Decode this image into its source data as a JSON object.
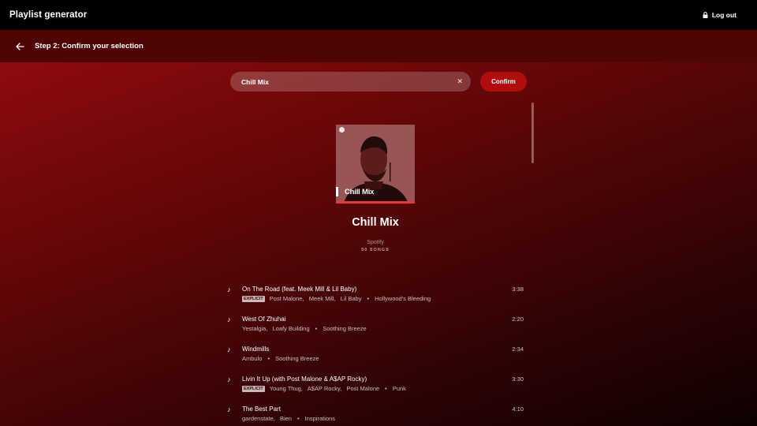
{
  "app": {
    "title": "Playlist generator",
    "logout_label": "Log out"
  },
  "step": {
    "title": "Step 2: Confirm your selection"
  },
  "search": {
    "value": "Chill Mix",
    "clear_icon": "close-icon"
  },
  "confirm_label": "Confirm",
  "playlist": {
    "cover_title": "Chill Mix",
    "name": "Chill Mix",
    "owner": "Spotify",
    "count": "50 SONGS"
  },
  "tracks": [
    {
      "title": "On The Road (feat. Meek Mill & Lil Baby)",
      "explicit": "EXPLICIT",
      "artists": "Post Malone,   Meek Mill,   Lil Baby",
      "album": "Hollywood's Bleeding",
      "duration": "3:38"
    },
    {
      "title": "West Of Zhuhai",
      "explicit": "",
      "artists": "Yestalgia,   Loafy Building",
      "album": "Soothing Breeze",
      "duration": "2:20"
    },
    {
      "title": "Windmills",
      "explicit": "",
      "artists": "Ambulo",
      "album": "Soothing Breeze",
      "duration": "2:34"
    },
    {
      "title": "Livin It Up (with Post Malone & A$AP Rocky)",
      "explicit": "EXPLICIT",
      "artists": "Young Thug,   A$AP Rocky,   Post Malone",
      "album": "Punk",
      "duration": "3:30"
    },
    {
      "title": "The Best Part",
      "explicit": "",
      "artists": "gardenstate,   Bien",
      "album": "Inspirations",
      "duration": "4:10"
    }
  ],
  "separator": "•",
  "colors": {
    "accent": "#b00d0f",
    "topbar": "#000000",
    "stepbar": "#4f0506"
  }
}
